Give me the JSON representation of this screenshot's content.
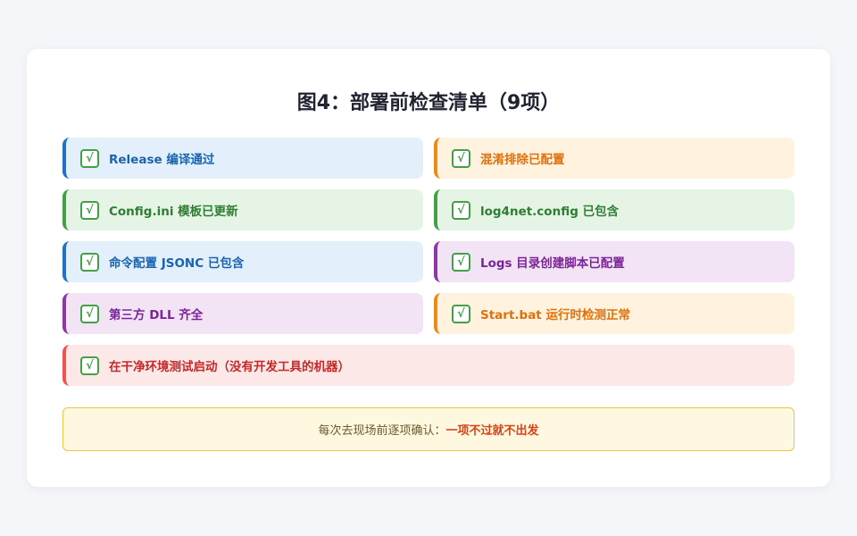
{
  "title": "图4：部署前检查清单（9项）",
  "check_glyph": "√",
  "items": [
    {
      "label": "Release 编译通过",
      "theme": "blue",
      "accent": "#1e73c8"
    },
    {
      "label": "混淆排除已配置",
      "theme": "orange",
      "accent": "#ef8a14"
    },
    {
      "label": "Config.ini 模板已更新",
      "theme": "green",
      "accent": "#43a047"
    },
    {
      "label": "log4net.config 已包含",
      "theme": "green",
      "accent": "#43a047"
    },
    {
      "label": "命令配置 JSONC 已包含",
      "theme": "blue",
      "accent": "#1e73c8"
    },
    {
      "label": "Logs 目录创建脚本已配置",
      "theme": "purple",
      "accent": "#8e35a8"
    },
    {
      "label": "第三方 DLL 齐全",
      "theme": "purple",
      "accent": "#8e35a8"
    },
    {
      "label": "Start.bat 运行时检测正常",
      "theme": "orange",
      "accent": "#ef8a14"
    },
    {
      "label": "在干净环境测试启动（没有开发工具的机器）",
      "theme": "red",
      "accent": "#ef5350"
    }
  ],
  "note": {
    "prefix": "每次去现场前逐项确认：",
    "emphasis": "一项不过就不出发"
  }
}
